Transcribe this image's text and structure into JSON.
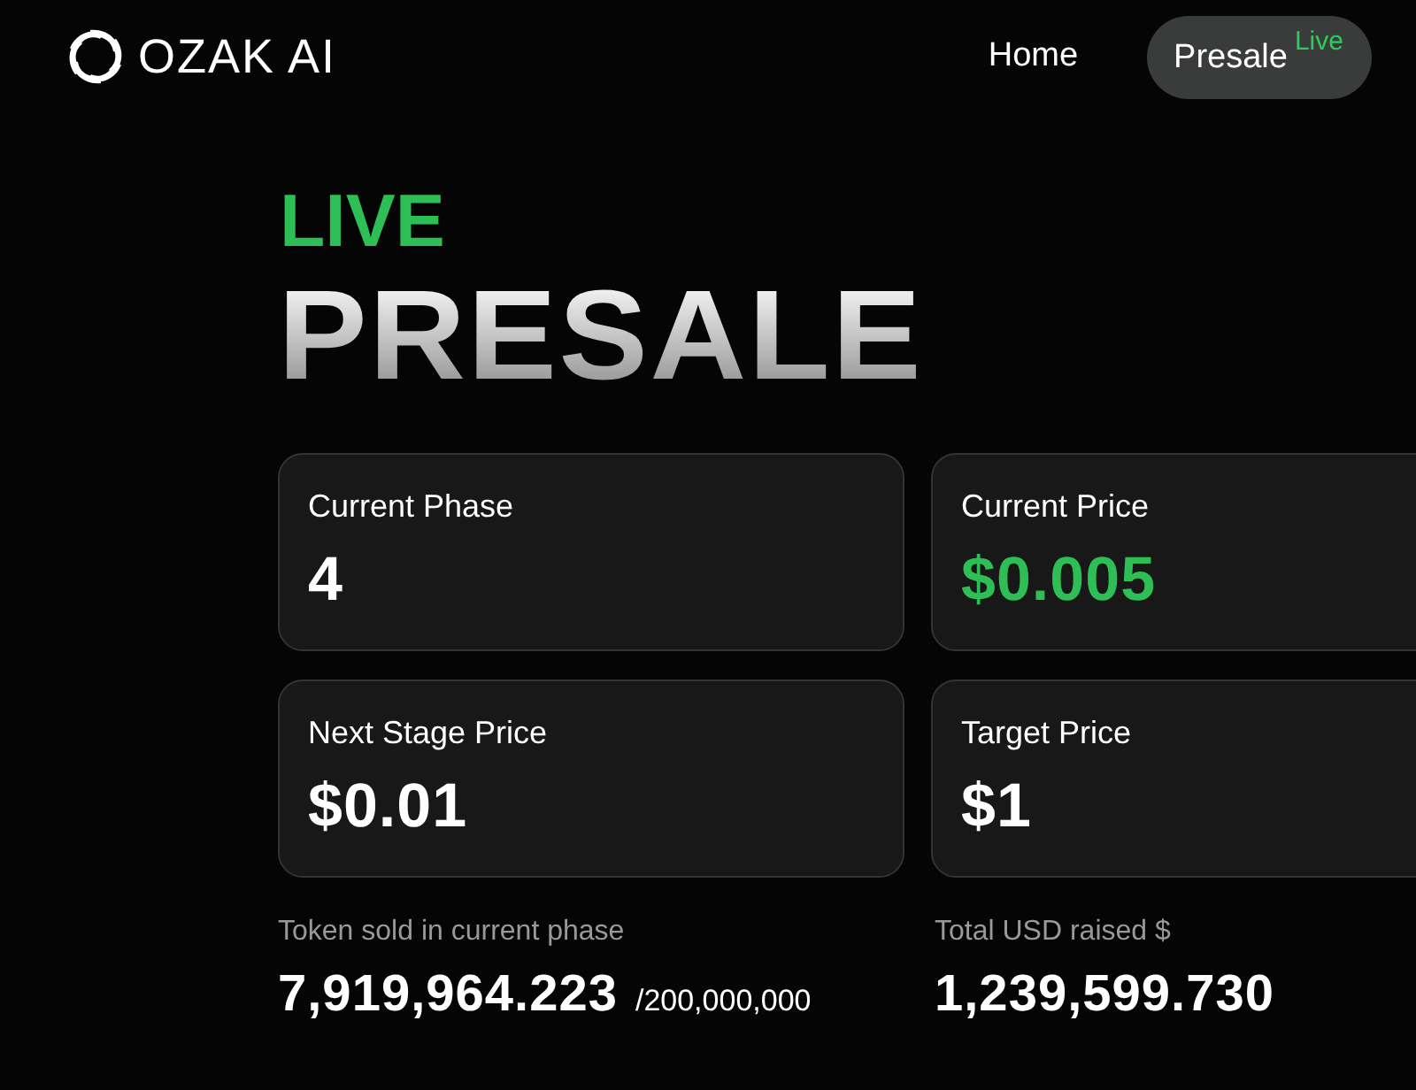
{
  "brand": "OZAK AI",
  "nav": [
    {
      "label": "Home",
      "selected": false
    },
    {
      "label": "Presale",
      "selected": true,
      "badge": "Live"
    }
  ],
  "hero": {
    "eyebrow": "LIVE",
    "title": "PRESALE"
  },
  "cards": [
    {
      "label": "Current Phase",
      "value": "4",
      "highlight": false
    },
    {
      "label": "Current Price",
      "value": "$0.005",
      "highlight": true
    },
    {
      "label": "Next Stage Price",
      "value": "$0.01",
      "highlight": false
    },
    {
      "label": "Target Price",
      "value": "$1",
      "highlight": false
    }
  ],
  "stats": [
    {
      "label": "Token sold in current phase",
      "value": "7,919,964.223",
      "total": "/200,000,000"
    },
    {
      "label": "Total USD raised $",
      "value": "1,239,599.730"
    }
  ]
}
